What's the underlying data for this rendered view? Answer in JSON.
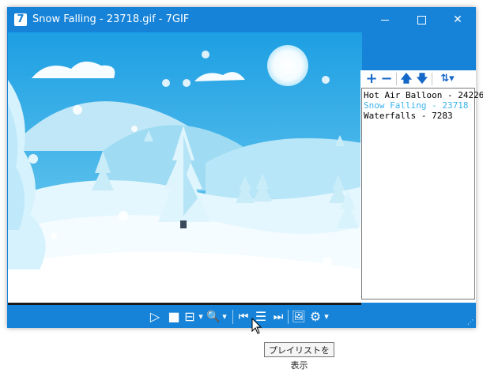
{
  "window": {
    "title": "Snow Falling - 23718.gif - 7GIF",
    "app_icon_glyph": "7",
    "controls": {
      "minimize_icon": "minimize-icon",
      "maximize_icon": "maximize-icon",
      "close_glyph": "✕"
    }
  },
  "playlist": {
    "toolbar": {
      "add": "+",
      "remove": "−",
      "up": "🡅",
      "down": "🡇",
      "sort": "⇅▾"
    },
    "items": [
      {
        "label": "Hot Air Balloon - 24226",
        "selected": false
      },
      {
        "label": "Snow Falling - 23718",
        "selected": true
      },
      {
        "label": "Waterfalls - 7283",
        "selected": false
      }
    ]
  },
  "toolbar": {
    "play": "▷",
    "stop": "■",
    "frames": "⊟",
    "frames_menu": "▾",
    "zoom": "🔍",
    "zoom_menu": "▾",
    "prev": "⏮",
    "playlist": "☰",
    "next": "⏭",
    "capture": "🖼",
    "settings": "⚙",
    "settings_menu": "▾"
  },
  "tooltip": "プレイリストを表示",
  "colors": {
    "accent": "#1683d8",
    "selected_item": "#39b3ee",
    "scene_sky": "#29a8e6"
  }
}
